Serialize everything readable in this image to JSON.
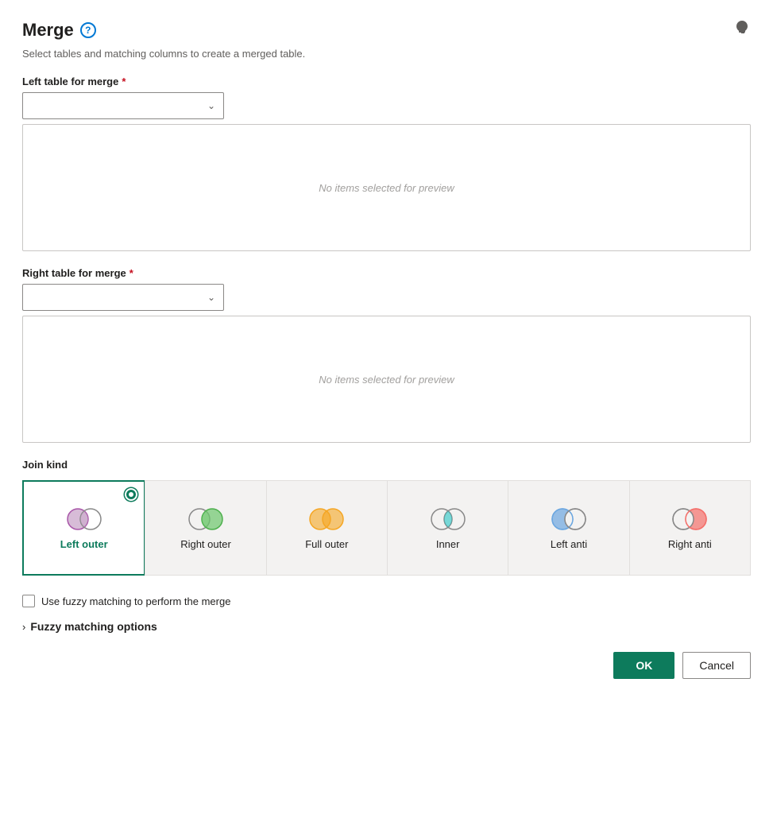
{
  "header": {
    "title": "Merge",
    "subtitle": "Select tables and matching columns to create a merged table.",
    "help_icon_label": "?",
    "lightbulb_icon": "💡"
  },
  "left_table": {
    "label": "Left table for merge",
    "required": true,
    "placeholder": "",
    "preview_text": "No items selected for preview"
  },
  "right_table": {
    "label": "Right table for merge",
    "required": true,
    "placeholder": "",
    "preview_text": "No items selected for preview"
  },
  "join_kind": {
    "section_label": "Join kind",
    "options": [
      {
        "id": "left-outer",
        "label": "Left outer",
        "selected": true
      },
      {
        "id": "right-outer",
        "label": "Right outer",
        "selected": false
      },
      {
        "id": "full-outer",
        "label": "Full outer",
        "selected": false
      },
      {
        "id": "inner",
        "label": "Inner",
        "selected": false
      },
      {
        "id": "left-anti",
        "label": "Left anti",
        "selected": false
      },
      {
        "id": "right-anti",
        "label": "Right anti",
        "selected": false
      }
    ]
  },
  "fuzzy": {
    "checkbox_label": "Use fuzzy matching to perform the merge",
    "options_label": "Fuzzy matching options",
    "chevron": "›"
  },
  "footer": {
    "ok_label": "OK",
    "cancel_label": "Cancel"
  }
}
